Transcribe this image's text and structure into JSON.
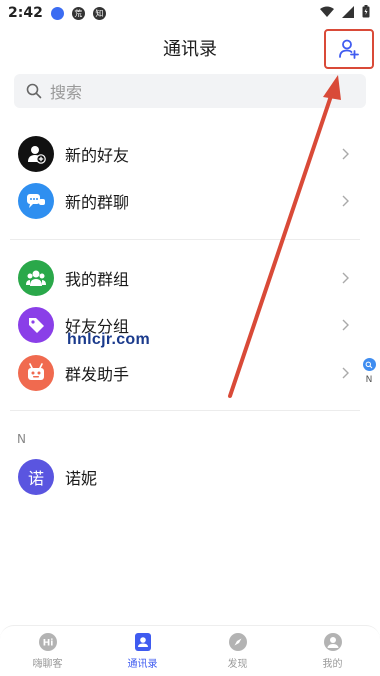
{
  "status_bar": {
    "time": "2:42",
    "icons": [
      "app-notification-icon",
      "app-notification-icon",
      "app-notification-icon",
      "wifi-icon",
      "signal-icon",
      "battery-icon"
    ],
    "badge_texts": [
      "",
      "荒",
      "知"
    ]
  },
  "header": {
    "title": "通讯录",
    "action_icon": "add-friend-icon"
  },
  "search": {
    "placeholder": "搜索",
    "icon": "search-icon"
  },
  "sections": {
    "top": [
      {
        "label": "新的好友",
        "icon": "person-add-icon",
        "color": "#111111"
      },
      {
        "label": "新的群聊",
        "icon": "group-chat-icon",
        "color": "#2f8ff0"
      }
    ],
    "groups": [
      {
        "label": "我的群组",
        "icon": "group-icon",
        "color": "#2aa84a"
      },
      {
        "label": "好友分组",
        "icon": "tag-icon",
        "color": "#8a3fe8"
      },
      {
        "label": "群发助手",
        "icon": "robot-icon",
        "color": "#f06a4f"
      }
    ],
    "contacts_letter": "N",
    "contacts": [
      {
        "label": "诺妮",
        "avatar_text": "诺",
        "color": "#5a55e0"
      }
    ]
  },
  "watermark": "hnlcjr.com",
  "index_bar": {
    "search_icon": "search-icon",
    "letters": [
      "N"
    ]
  },
  "tabbar": {
    "tabs": [
      {
        "label": "嗨聊客",
        "icon": "chat-bubble-icon",
        "active": false
      },
      {
        "label": "通讯录",
        "icon": "contacts-icon",
        "active": true
      },
      {
        "label": "发现",
        "icon": "compass-icon",
        "active": false
      },
      {
        "label": "我的",
        "icon": "profile-icon",
        "active": false
      }
    ],
    "active_color": "#3f5bf0",
    "inactive_color": "#b3b3b3"
  },
  "annotation_color": "#d94a38"
}
